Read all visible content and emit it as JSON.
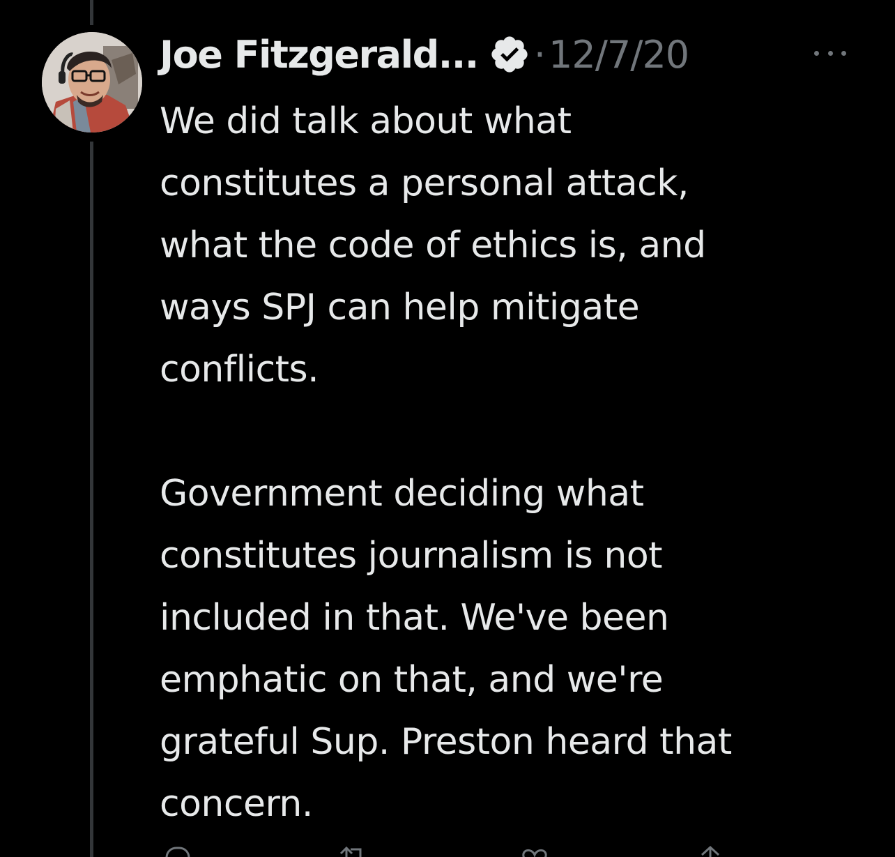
{
  "tweet": {
    "author": {
      "display_name": "Joe Fitzgerald...",
      "verified": true,
      "avatar_icon": "user-avatar-photo"
    },
    "separator": "·",
    "timestamp": "12/7/20",
    "text": "We did talk about what\nconstitutes a personal attack,\nwhat the code of ethics is, and\nways SPJ can help mitigate\nconflicts.\n\nGovernment deciding what\nconstitutes journalism is not\nincluded in that. We've been\nemphatic on that, and we're\ngrateful Sup. Preston heard that\nconcern."
  },
  "actions": [
    {
      "name": "reply",
      "icon": "reply-icon"
    },
    {
      "name": "retweet",
      "icon": "retweet-icon"
    },
    {
      "name": "like",
      "icon": "like-icon"
    },
    {
      "name": "share",
      "icon": "share-icon"
    }
  ],
  "colors": {
    "background": "#000000",
    "primary_text": "#e7e9ea",
    "secondary_text": "#71767b",
    "thread_line": "#333639"
  }
}
